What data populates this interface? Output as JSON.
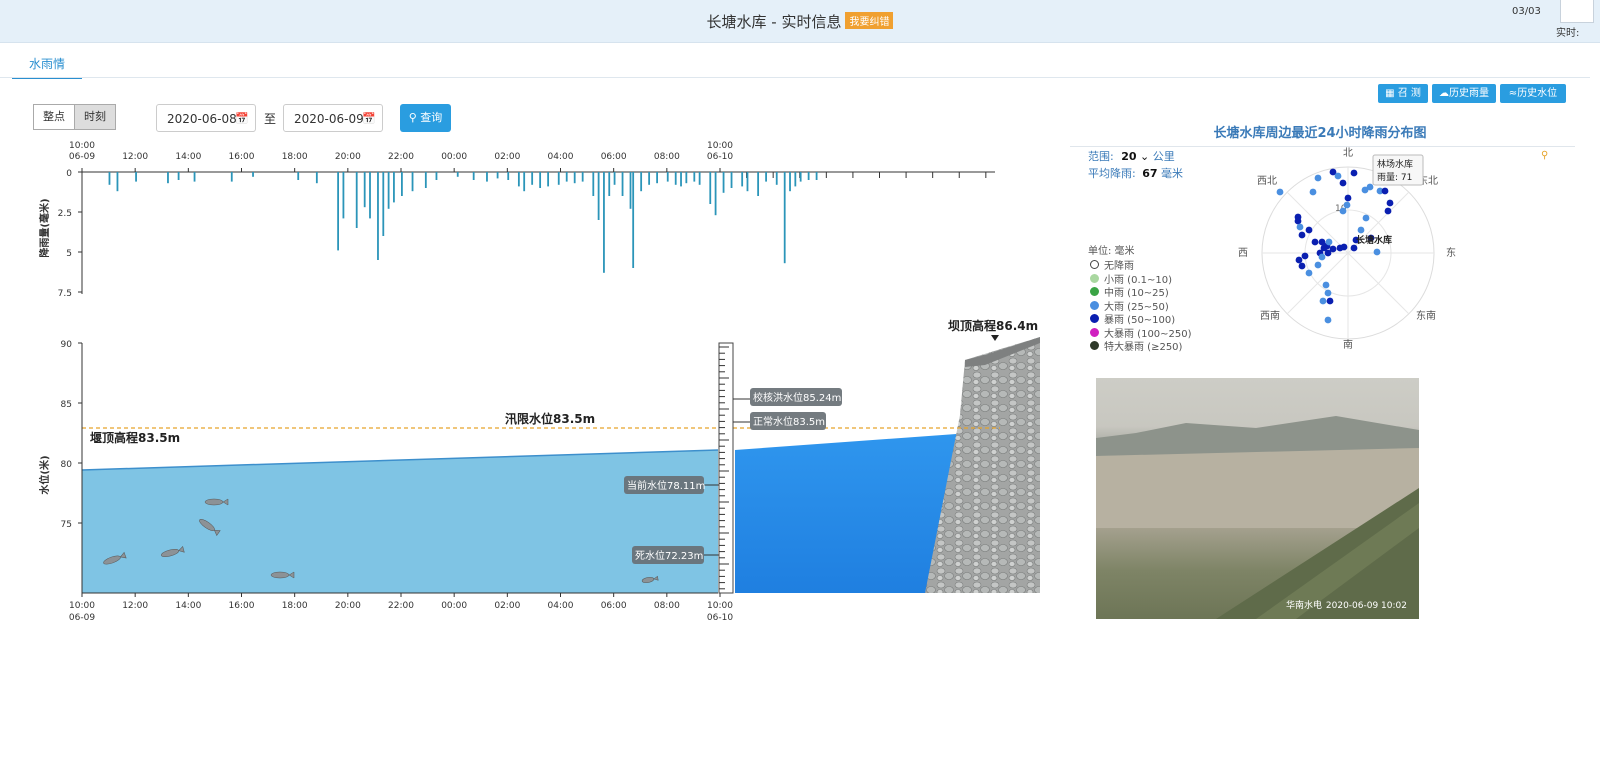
{
  "header": {
    "title": "长塘水库 - 实时信息",
    "badge": "我要纠错",
    "page_indicator": "03/03",
    "realtime_label": "实时:"
  },
  "tabs": [
    {
      "label": "水雨情",
      "active": true
    }
  ],
  "controls": {
    "mode_options": [
      "整点",
      "时刻"
    ],
    "mode_selected": "时刻",
    "start_date": "2020-06-08",
    "end_date": "2020-06-09",
    "to_label": "至",
    "query_label": "查询",
    "buttons": [
      "召 测",
      "历史雨量",
      "历史水位"
    ]
  },
  "rain_chart": {
    "ylabel": "降雨量(毫米)",
    "yticks": [
      "0",
      "2.5",
      "5",
      "7.5"
    ],
    "xticks": [
      "10:00\n06-09",
      "12:00",
      "14:00",
      "16:00",
      "18:00",
      "20:00",
      "22:00",
      "00:00",
      "02:00",
      "04:00",
      "06:00",
      "08:00",
      "10:00\n06-10"
    ]
  },
  "water_chart": {
    "ylabel": "水位(米)",
    "yticks": [
      "90",
      "85",
      "80",
      "75"
    ],
    "xticks": [
      "10:00\n06-09",
      "12:00",
      "14:00",
      "16:00",
      "18:00",
      "20:00",
      "22:00",
      "00:00",
      "02:00",
      "04:00",
      "06:00",
      "08:00",
      "10:00\n06-10"
    ],
    "weir_label": "堰顶高程83.5m",
    "flood_limit_label": "汛限水位83.5m",
    "dam_crest_label": "坝顶高程86.4m",
    "check_flood_label": "校核洪水位85.24m",
    "normal_level_label": "正常水位83.5m",
    "current_level_label": "当前水位78.11m",
    "dead_level_label": "死水位72.23m"
  },
  "chart_data": {
    "type": "bar",
    "x_range": [
      "2020-06-09 10:00",
      "2020-06-10 10:00"
    ],
    "ylim": [
      0,
      7.5
    ],
    "rain_bars": [
      [
        1.0,
        0.8
      ],
      [
        1.3,
        1.2
      ],
      [
        2.0,
        0.6
      ],
      [
        3.2,
        0.7
      ],
      [
        3.6,
        0.5
      ],
      [
        4.2,
        0.6
      ],
      [
        5.6,
        0.6
      ],
      [
        6.4,
        0.3
      ],
      [
        8.1,
        0.5
      ],
      [
        8.8,
        0.7
      ],
      [
        9.6,
        4.9
      ],
      [
        9.8,
        2.9
      ],
      [
        10.3,
        3.5
      ],
      [
        10.6,
        2.2
      ],
      [
        10.8,
        2.9
      ],
      [
        11.1,
        5.5
      ],
      [
        11.3,
        4.0
      ],
      [
        11.5,
        2.3
      ],
      [
        11.7,
        1.9
      ],
      [
        12.0,
        1.5
      ],
      [
        12.4,
        1.2
      ],
      [
        12.9,
        1.0
      ],
      [
        13.3,
        0.5
      ],
      [
        14.1,
        0.3
      ],
      [
        14.7,
        0.5
      ],
      [
        15.2,
        0.6
      ],
      [
        15.6,
        0.4
      ],
      [
        16.0,
        0.5
      ],
      [
        16.4,
        0.9
      ],
      [
        16.6,
        1.2
      ],
      [
        16.9,
        0.8
      ],
      [
        17.2,
        1.0
      ],
      [
        17.5,
        0.9
      ],
      [
        17.9,
        0.8
      ],
      [
        18.2,
        0.6
      ],
      [
        18.5,
        0.7
      ],
      [
        18.8,
        0.6
      ],
      [
        19.2,
        1.5
      ],
      [
        19.4,
        3.0
      ],
      [
        19.6,
        6.3
      ],
      [
        19.8,
        1.5
      ],
      [
        20.0,
        0.8
      ],
      [
        20.3,
        1.5
      ],
      [
        20.6,
        2.3
      ],
      [
        20.7,
        6.0
      ],
      [
        21.0,
        1.2
      ],
      [
        21.3,
        0.8
      ],
      [
        21.6,
        0.7
      ],
      [
        22.0,
        0.6
      ],
      [
        22.3,
        0.8
      ],
      [
        22.5,
        0.9
      ],
      [
        22.7,
        0.7
      ],
      [
        23.0,
        0.6
      ],
      [
        23.2,
        0.8
      ],
      [
        23.6,
        2.0
      ],
      [
        23.8,
        2.7
      ],
      [
        24.1,
        1.3
      ],
      [
        24.4,
        1.0
      ],
      [
        24.8,
        0.9
      ],
      [
        25.0,
        1.2
      ],
      [
        25.4,
        1.5
      ],
      [
        25.7,
        0.6
      ],
      [
        26.1,
        0.8
      ],
      [
        26.4,
        5.7
      ],
      [
        26.6,
        1.2
      ],
      [
        26.8,
        0.9
      ],
      [
        27.0,
        0.6
      ],
      [
        27.3,
        0.5
      ],
      [
        27.6,
        0.5
      ]
    ],
    "water_level_series": [
      {
        "x": "2020-06-09 10:00",
        "y": 80.1
      },
      {
        "x": "2020-06-10 10:00",
        "y": 81.0
      }
    ],
    "water_ylim": [
      70,
      90
    ]
  },
  "radar": {
    "title": "长塘水库周边最近24小时降雨分布图",
    "range_label": "范围:",
    "range_value": "20",
    "range_unit": "公里",
    "avg_label": "平均降雨:",
    "avg_value": "67",
    "avg_unit": "毫米",
    "unit_label": "单位: 毫米",
    "directions": [
      "北",
      "东北",
      "东",
      "东南",
      "南",
      "西南",
      "西",
      "西北"
    ],
    "ring_label": "10",
    "center_label": "长塘水库",
    "tooltip_name": "林场水库",
    "tooltip_value": "雨量: 71",
    "legend": [
      {
        "label": "无降雨",
        "color": "#ffffff"
      },
      {
        "label": "小雨 (0.1~10)",
        "color": "#a9d7a0"
      },
      {
        "label": "中雨 (10~25)",
        "color": "#3aa445"
      },
      {
        "label": "大雨 (25~50)",
        "color": "#4a8fe0"
      },
      {
        "label": "暴雨 (50~100)",
        "color": "#0a1fb0"
      },
      {
        "label": "大暴雨 (100~250)",
        "color": "#d020c0"
      },
      {
        "label": "特大暴雨 (≥250)",
        "color": "#2f3a2a"
      }
    ]
  },
  "camera": {
    "brand": "华南水电",
    "timestamp": "2020-06-09 10:02"
  }
}
